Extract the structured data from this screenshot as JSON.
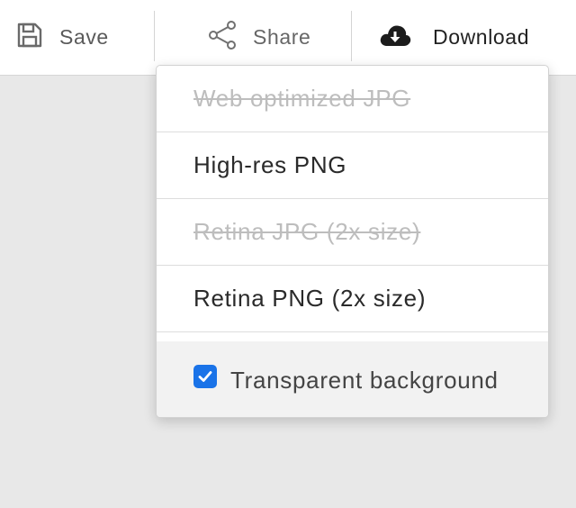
{
  "toolbar": {
    "save": {
      "label": "Save",
      "icon": "floppy-disk-icon"
    },
    "share": {
      "label": "Share",
      "icon": "share-icon"
    },
    "download": {
      "label": "Download",
      "icon": "cloud-download-icon"
    }
  },
  "download_menu": {
    "items": [
      {
        "label": "Web optimized JPG",
        "enabled": false
      },
      {
        "label": "High-res PNG",
        "enabled": true
      },
      {
        "label": "Retina JPG (2x size)",
        "enabled": false
      },
      {
        "label": "Retina PNG (2x size)",
        "enabled": true
      }
    ],
    "transparent_background": {
      "label": "Transparent background",
      "checked": true
    }
  },
  "colors": {
    "accent": "#1a73e8",
    "disabled_text": "#bdbdbd",
    "backdrop": "#e8e8e8"
  }
}
